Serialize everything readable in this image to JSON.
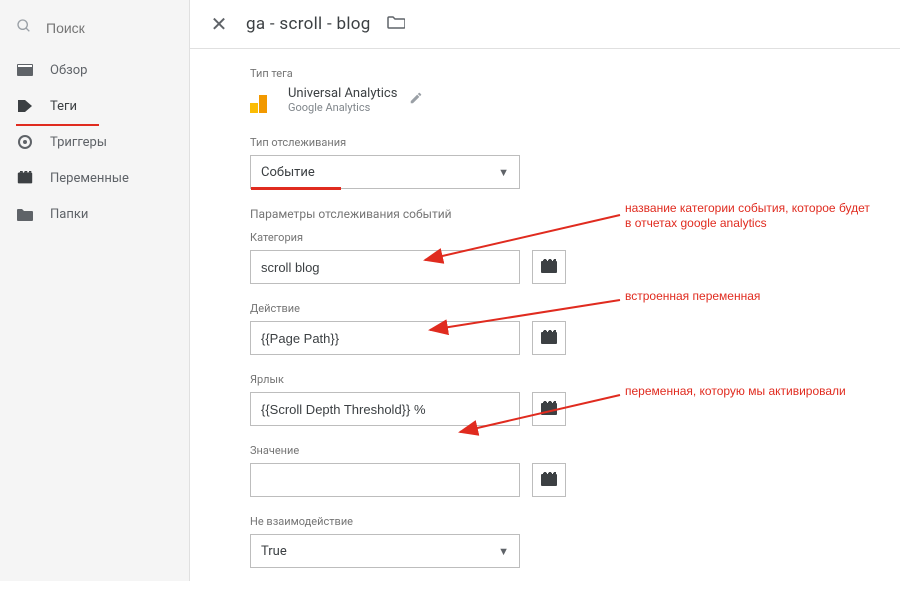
{
  "sidebar": {
    "search_placeholder": "Поиск",
    "items": [
      {
        "label": "Обзор"
      },
      {
        "label": "Теги"
      },
      {
        "label": "Триггеры"
      },
      {
        "label": "Переменные"
      },
      {
        "label": "Папки"
      }
    ],
    "active_index": 1
  },
  "header": {
    "title": "ga - scroll - blog"
  },
  "tag": {
    "section_label": "Тип тега",
    "type_name": "Universal Analytics",
    "type_sub": "Google Analytics",
    "track_type_label": "Тип отслеживания",
    "track_type_value": "Событие",
    "params_label": "Параметры отслеживания событий",
    "category_label": "Категория",
    "category_value": "scroll blog",
    "action_label": "Действие",
    "action_value": "{{Page Path}}",
    "label_label": "Ярлык",
    "label_value": "{{Scroll Depth Threshold}} %",
    "value_label": "Значение",
    "value_value": "",
    "noninteraction_label": "Не взаимодействие",
    "noninteraction_value": "True"
  },
  "annotations": {
    "a1_line1": "название категории события, которое будет",
    "a1_line2": "в отчетах google analytics",
    "a2": "встроенная переменная",
    "a3": "переменная, которую мы активировали"
  }
}
